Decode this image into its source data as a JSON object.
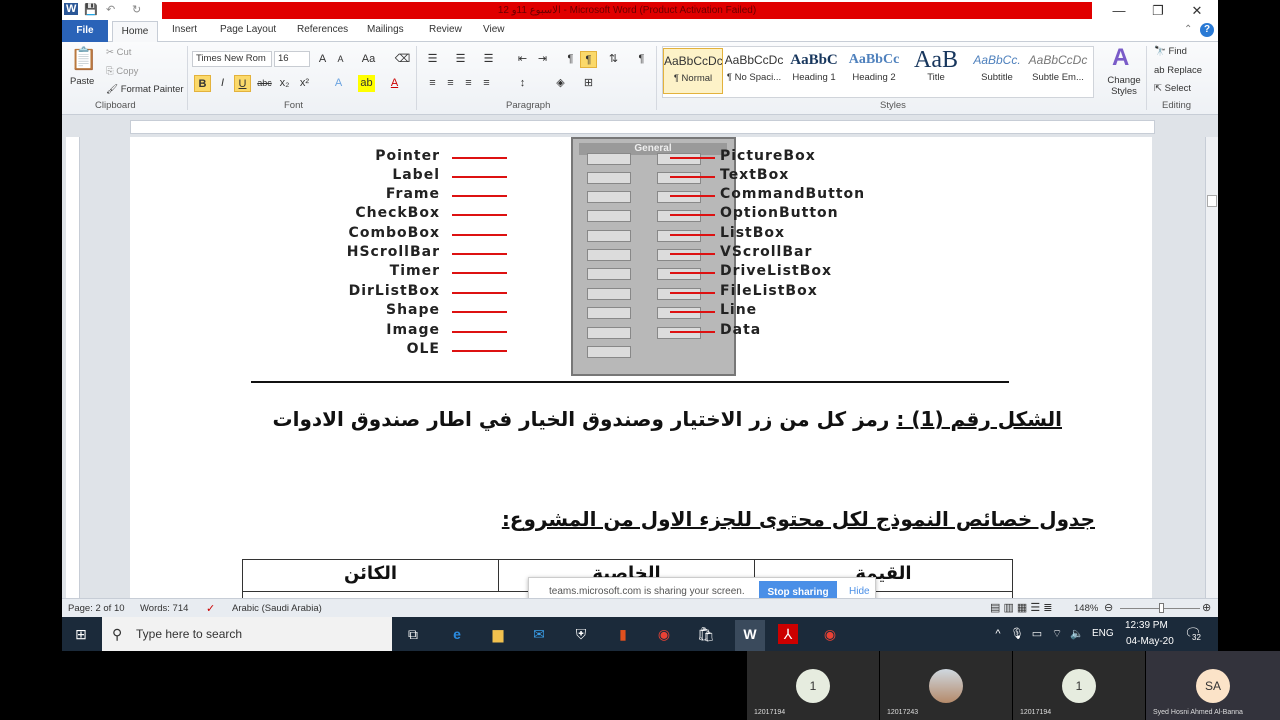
{
  "window": {
    "title": "الاسبوع 11و 12 - Microsoft Word (Product Activation Failed)",
    "minimize": "—",
    "restore": "❐",
    "close": "✕"
  },
  "tabs": [
    "File",
    "Home",
    "Insert",
    "Page Layout",
    "References",
    "Mailings",
    "Review",
    "View"
  ],
  "ribbon": {
    "clipboard": {
      "paste": "Paste",
      "cut": "Cut",
      "copy": "Copy",
      "format_painter": "Format Painter",
      "group": "Clipboard"
    },
    "font": {
      "name": "Times New Rom",
      "size": "16",
      "group": "Font"
    },
    "paragraph": {
      "group": "Paragraph"
    },
    "styles": {
      "items": [
        {
          "preview": "AaBbCcDc",
          "name": "¶ Normal"
        },
        {
          "preview": "AaBbCcDc",
          "name": "¶ No Spaci..."
        },
        {
          "preview": "AaBbC",
          "name": "Heading 1"
        },
        {
          "preview": "AaBbCc",
          "name": "Heading 2"
        },
        {
          "preview": "AaB",
          "name": "Title"
        },
        {
          "preview": "AaBbCc.",
          "name": "Subtitle"
        },
        {
          "preview": "AaBbCcDc",
          "name": "Subtle Em..."
        }
      ],
      "change_styles": "Change Styles",
      "group": "Styles"
    },
    "editing": {
      "find": "Find",
      "replace": "Replace",
      "select": "Select",
      "group": "Editing"
    }
  },
  "document": {
    "toolbox_header": "General",
    "left_tools": [
      "Pointer",
      "Label",
      "Frame",
      "CheckBox",
      "ComboBox",
      "HScrollBar",
      "Timer",
      "DirListBox",
      "Shape",
      "Image",
      "OLE"
    ],
    "right_tools": [
      "PictureBox",
      "TextBox",
      "CommandButton",
      "OptionButton",
      "ListBox",
      "VScrollBar",
      "DriveListBox",
      "FileListBox",
      "Line",
      "Data"
    ],
    "caption_label": "الشكل رقم (1) :",
    "caption_text": " رمز كل من زر الاختيار وصندوق الخيار في اطار صندوق الادوات",
    "heading": "جدول خصائص النموذج لكل محتوى للجزء الاول من المشروع:",
    "table_headers": [
      "القيمة",
      "الخاصية",
      "الكائن"
    ]
  },
  "status": {
    "page": "Page: 2 of 10",
    "words": "Words: 714",
    "language": "Arabic (Saudi Arabia)",
    "zoom": "148%"
  },
  "share_bar": {
    "text": "teams.microsoft.com is sharing your screen.",
    "stop": "Stop sharing",
    "hide": "Hide"
  },
  "taskbar": {
    "search_placeholder": "Type here to search",
    "lang": "ENG",
    "time": "12:39 PM",
    "date": "04-May-20",
    "notifications": "32"
  },
  "participants": [
    {
      "avatar": "1",
      "name": "12017194"
    },
    {
      "avatar": "",
      "name": "12017243"
    },
    {
      "avatar": "1",
      "name": "12017194"
    },
    {
      "avatar": "SA",
      "name": "Syed Hosni Ahmed Al-Banna"
    }
  ]
}
